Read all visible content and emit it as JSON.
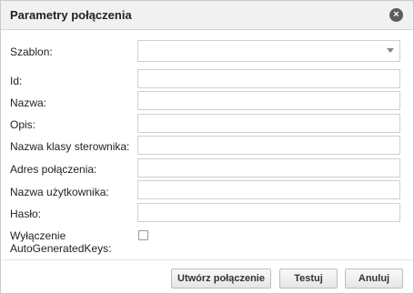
{
  "dialog": {
    "title": "Parametry połączenia",
    "close_icon": "close-icon"
  },
  "form": {
    "template_label": "Szablon:",
    "template_value": "",
    "id_label": "Id:",
    "id_value": "",
    "name_label": "Nazwa:",
    "name_value": "",
    "description_label": "Opis:",
    "description_value": "",
    "driver_label": "Nazwa klasy sterownika:",
    "driver_value": "",
    "address_label": "Adres połączenia:",
    "address_value": "",
    "user_label": "Nazwa użytkownika:",
    "user_value": "",
    "password_label": "Hasło:",
    "password_value": "",
    "agk_label_line1": "Wyłączenie",
    "agk_label_line2": "AutoGeneratedKeys:",
    "agk_checked": false
  },
  "buttons": {
    "create": "Utwórz połączenie",
    "test": "Testuj",
    "cancel": "Anuluj"
  }
}
